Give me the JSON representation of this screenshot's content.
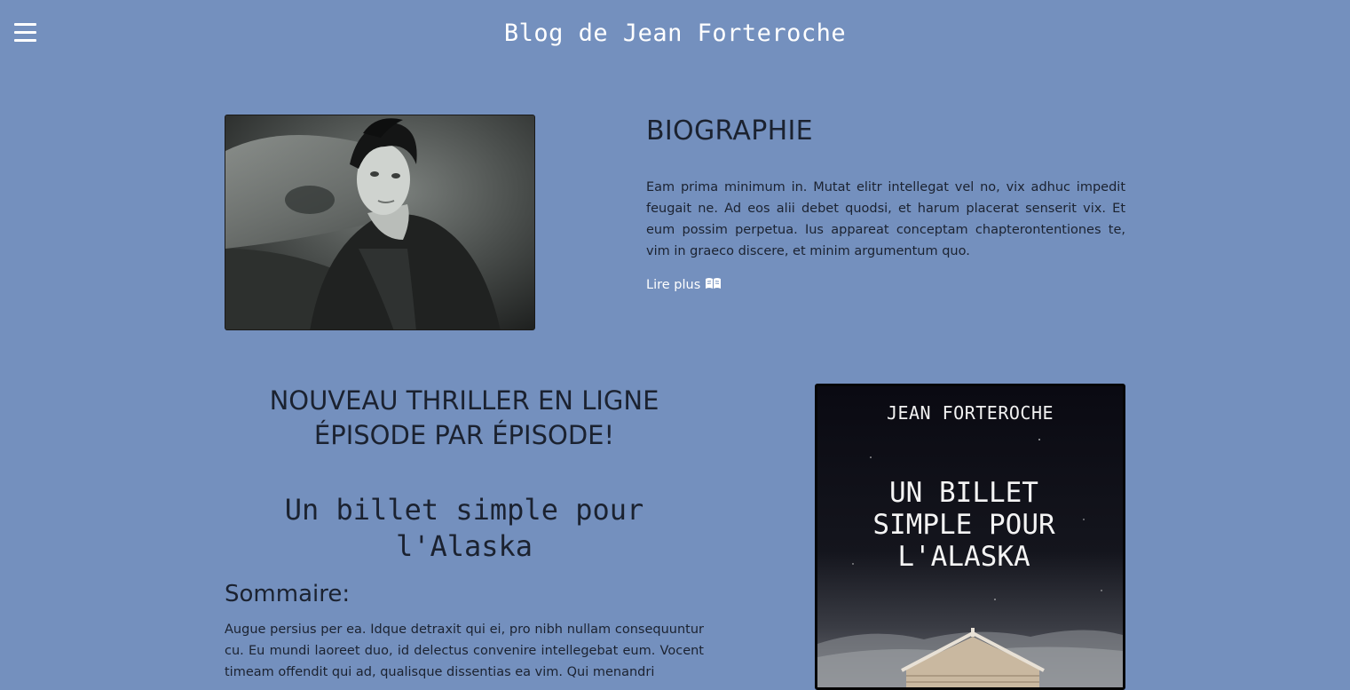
{
  "header": {
    "menu_icon": "hamburger-menu-icon",
    "site_title": "Blog de Jean Forteroche"
  },
  "biography": {
    "heading": "BIOGRAPHIE",
    "text": "Eam prima minimum in. Mutat elitr intellegat vel no, vix adhuc impedit feugait ne. Ad eos alii debet quodsi, et harum placerat senserit vix. Et eum possim perpetua. Ius appareat conceptam chapterontentiones te, vim in graeco discere, et minim argumentum quo.",
    "read_more_label": "Lire plus",
    "read_more_icon": "open-book-icon"
  },
  "novel": {
    "heading_line1": "NOUVEAU THRILLER EN LIGNE",
    "heading_line2": "ÉPISODE PAR ÉPISODE!",
    "title_line1": "Un billet simple pour",
    "title_line2": "l'Alaska",
    "summary_heading": "Sommaire:",
    "summary_text": "Augue persius per ea. Idque detraxit qui ei, pro nibh nullam consequuntur cu. Eu mundi laoreet duo, id delectus convenire intellegebat eum. Vocent timeam offendit qui ad, qualisque dissentias ea vim. Qui menandri"
  },
  "cover": {
    "author": "JEAN FORTEROCHE",
    "title_line1": "UN BILLET",
    "title_line2": "SIMPLE POUR",
    "title_line3": "L'ALASKA"
  },
  "colors": {
    "background": "#7490be",
    "text": "#1b2230",
    "header_text": "#ffffff"
  }
}
